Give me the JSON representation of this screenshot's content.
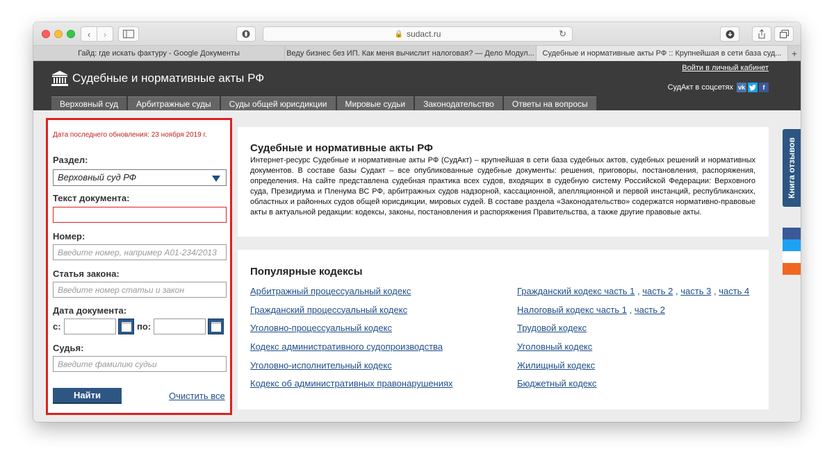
{
  "browser": {
    "address": "sudact.ru",
    "tabs": [
      "Гайд: где искать фактуру - Google Документы",
      "Веду бизнес без ИП. Как меня вычислит налоговая? — Дело Модул...",
      "Судебные и нормативные акты РФ :: Крупнейшая в сети база суд..."
    ]
  },
  "header": {
    "logo_text": "Судебные и нормативные акты РФ",
    "login": "Войти в личный кабинет",
    "social_label": "СудАкт в соцсетях",
    "social_vk": "vk",
    "social_fb": "f"
  },
  "nav": [
    "Верховный суд",
    "Арбитражные суды",
    "Суды общей юрисдикции",
    "Мировые судьи",
    "Законодательство",
    "Ответы на вопросы"
  ],
  "search": {
    "updated": "Дата последнего обновления: 23 ноября 2019 г.",
    "section_label": "Раздел:",
    "section_value": "Верховный суд РФ",
    "text_label": "Текст документа:",
    "number_label": "Номер:",
    "number_placeholder": "Введите номер, например А01-234/2013",
    "article_label": "Статья закона:",
    "article_placeholder": "Введите номер статьи и закон",
    "date_label": "Дата документа:",
    "date_from": "с:",
    "date_to": "по:",
    "judge_label": "Судья:",
    "judge_placeholder": "Введите фамилию судьи",
    "find": "Найти",
    "clear": "Очистить все"
  },
  "about": {
    "title": "Судебные и нормативные акты РФ",
    "text": "Интернет-ресурс Судебные и нормативные акты РФ (СудАкт) – крупнейшая в сети база судебных актов, судебных решений и нормативных документов. В составе базы Судакт – все опубликованные судебные документы: решения, приговоры, постановления, распоряжения, определения. На сайте представлена судебная практика всех судов, входящих в судебную систему Российской Федерации: Верховного суда, Президиума и Пленума ВС РФ, арбитражных судов надзорной, кассационной, апелляционной и первой инстанций, республиканских, областных и районных судов общей юрисдикции, мировых судей. В составе раздела «Законодательство» содержатся нормативно-правовые акты в актуальной редакции: кодексы, законы, постановления и распоряжения Правительства, а также другие правовые акты."
  },
  "codes": {
    "title": "Популярные кодексы",
    "left": [
      "Арбитражный процессуальный кодекс",
      "Гражданский процессуальный кодекс",
      "Уголовно-процессуальный кодекс",
      "Кодекс административного судопроизводства",
      "Уголовно-исполнительный кодекс",
      "Кодекс об административных правонарушениях"
    ],
    "right": {
      "civil": "Гражданский кодекс часть 1",
      "civil_p2": "часть 2",
      "civil_p3": "часть 3",
      "civil_p4": "часть 4",
      "tax": "Налоговый кодекс часть 1",
      "tax_p2": "часть 2",
      "labor": "Трудовой кодекс",
      "criminal": "Уголовный кодекс",
      "housing": "Жилищный кодекс",
      "budget": "Бюджетный кодекс",
      "comma": ","
    }
  },
  "feedback": "Книга отзывов",
  "colors": {
    "accent_blue": "#2d5683",
    "link": "#1f4e8a",
    "highlight_red": "#e02020",
    "header_dark": "#3b3b3b"
  }
}
